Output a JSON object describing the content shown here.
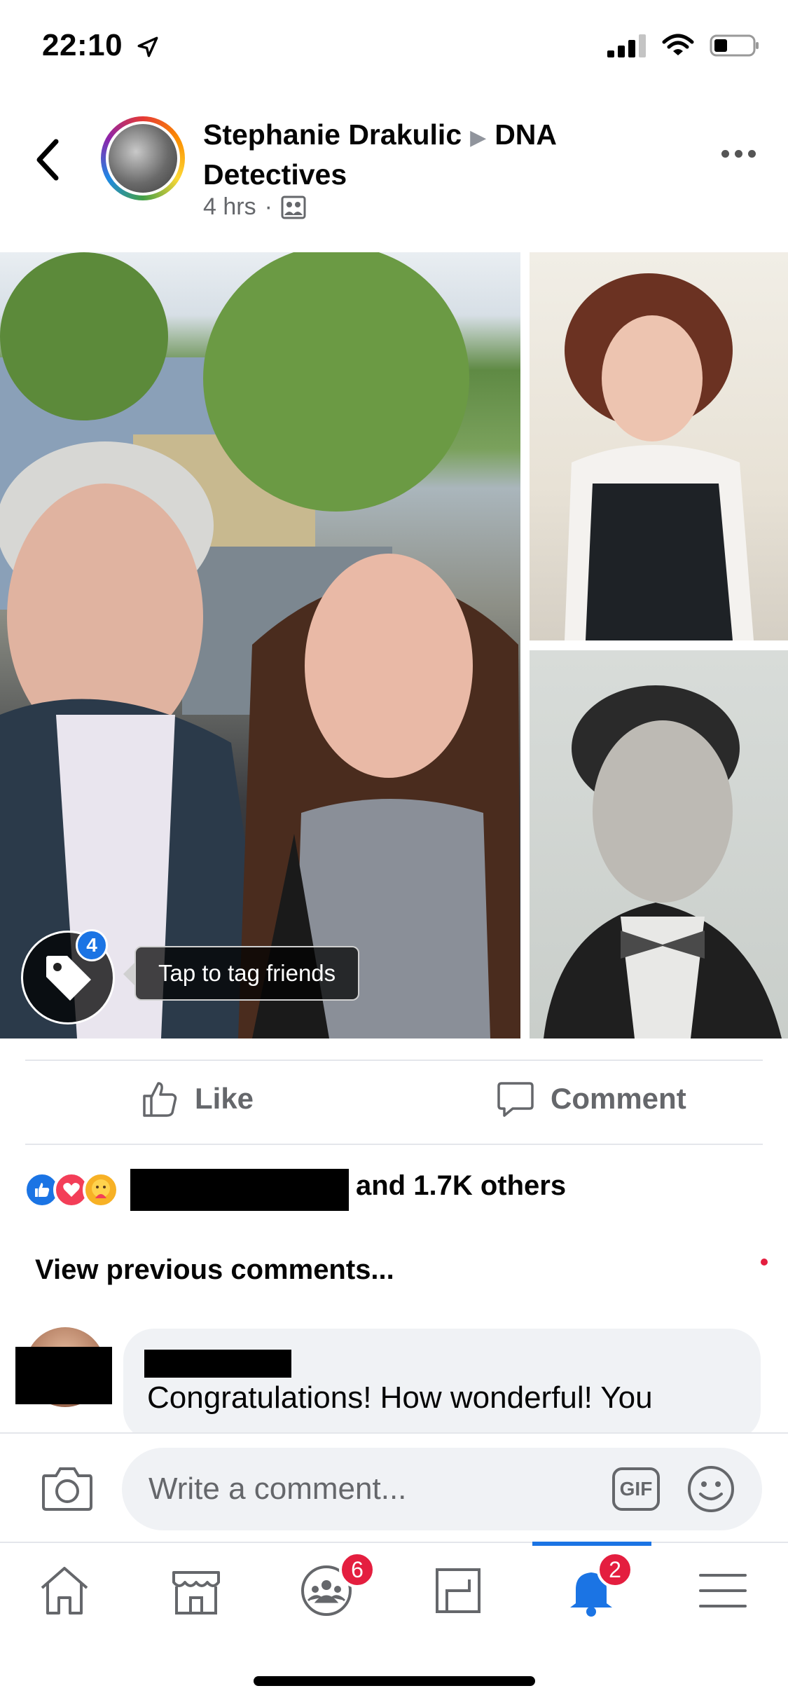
{
  "status_bar": {
    "time": "22:10"
  },
  "post": {
    "author": "Stephanie Drakulic",
    "group": "DNA Detectives",
    "time": "4 hrs",
    "tag_count": "4",
    "tag_hint": "Tap to tag friends"
  },
  "actions": {
    "like": "Like",
    "comment": "Comment"
  },
  "reactions": {
    "others": "and 1.7K others"
  },
  "comments": {
    "view_previous": "View previous comments...",
    "first_text": "Congratulations! How wonderful! You"
  },
  "composer": {
    "placeholder": "Write a comment...",
    "gif": "GIF"
  },
  "tabbar": {
    "groups_badge": "6",
    "notifications_badge": "2"
  },
  "colors": {
    "brand_blue": "#1b74e4",
    "badge_red": "#e41e3f"
  }
}
